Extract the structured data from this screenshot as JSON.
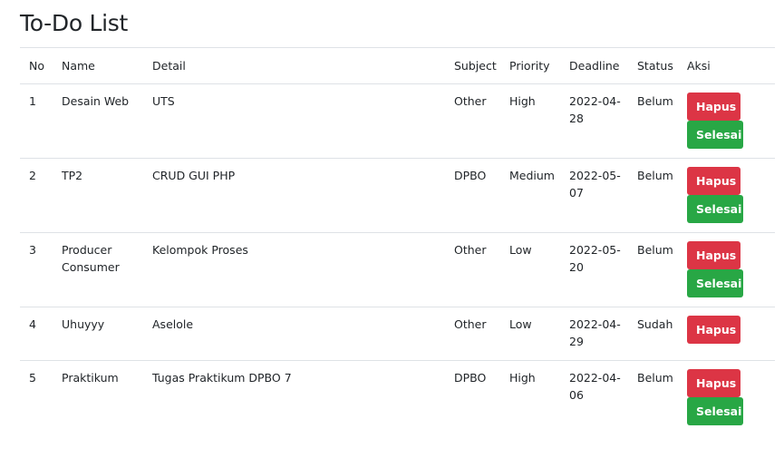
{
  "page": {
    "title": "To-Do List"
  },
  "table": {
    "headers": [
      "No",
      "Name",
      "Detail",
      "Subject",
      "Priority",
      "Deadline",
      "Status",
      "Aksi"
    ],
    "rows": [
      {
        "no": "1",
        "name": "Desain Web",
        "detail": "UTS",
        "subject": "Other",
        "priority": "High",
        "deadline": "2022-04-28",
        "status": "Belum",
        "actions": [
          "Hapus",
          "Selesai"
        ]
      },
      {
        "no": "2",
        "name": "TP2",
        "detail": "CRUD GUI PHP",
        "subject": "DPBO",
        "priority": "Medium",
        "deadline": "2022-05-07",
        "status": "Belum",
        "actions": [
          "Hapus",
          "Selesai"
        ]
      },
      {
        "no": "3",
        "name": "Producer Consumer",
        "detail": "Kelompok Proses",
        "subject": "Other",
        "priority": "Low",
        "deadline": "2022-05-20",
        "status": "Belum",
        "actions": [
          "Hapus",
          "Selesai"
        ]
      },
      {
        "no": "4",
        "name": "Uhuyyy",
        "detail": "Aselole",
        "subject": "Other",
        "priority": "Low",
        "deadline": "2022-04-29",
        "status": "Sudah",
        "actions": [
          "Hapus"
        ]
      },
      {
        "no": "5",
        "name": "Praktikum",
        "detail": "Tugas Praktikum DPBO 7",
        "subject": "DPBO",
        "priority": "High",
        "deadline": "2022-04-06",
        "status": "Belum",
        "actions": [
          "Hapus",
          "Selesai"
        ]
      }
    ]
  },
  "colors": {
    "hapus": "#dc3545",
    "selesai": "#28a745",
    "border": "#dee2e6",
    "text": "#212529"
  }
}
